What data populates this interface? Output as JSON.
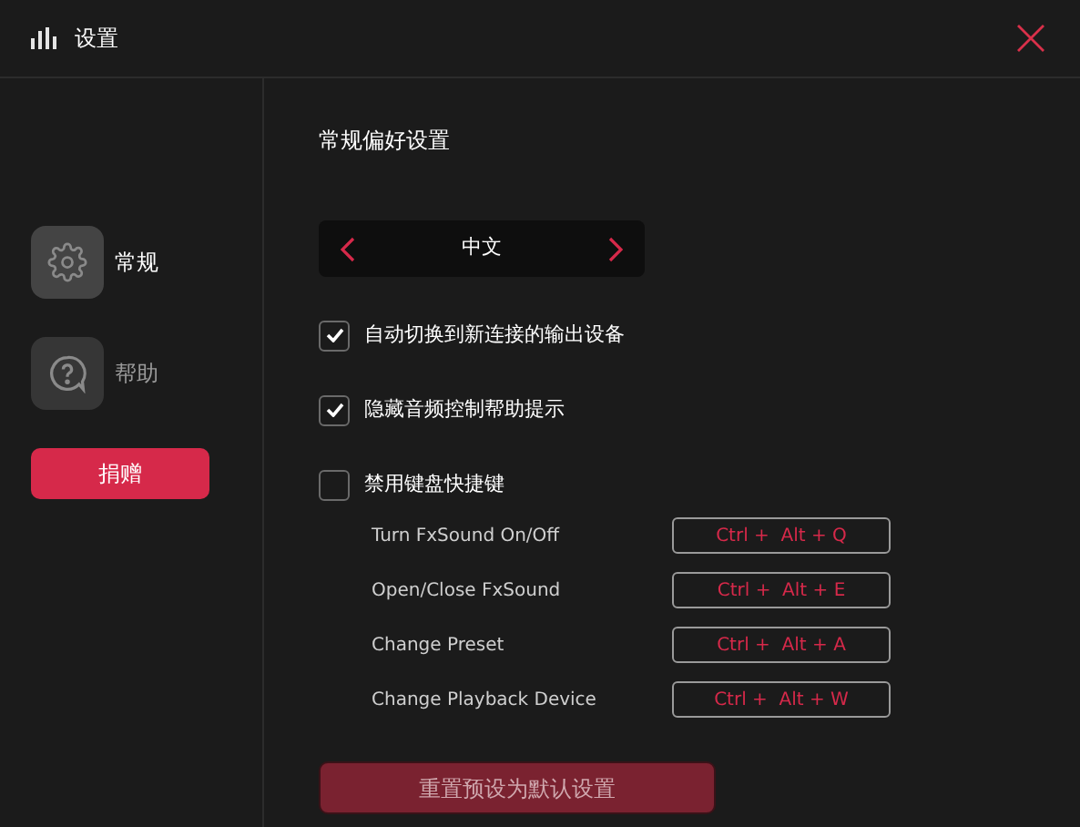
{
  "window": {
    "title": "设置"
  },
  "sidebar": {
    "items": [
      {
        "label": "常规",
        "kind": "settings",
        "selected": true
      },
      {
        "label": "帮助",
        "kind": "help",
        "selected": false
      }
    ],
    "donate_button": "捐赠"
  },
  "content": {
    "title": "常规偏好设置",
    "language": {
      "value": "中文"
    },
    "options": [
      {
        "label": "自动切换到新连接的输出设备",
        "checked": true
      },
      {
        "label": "隐藏音频控制帮助提示",
        "checked": true
      },
      {
        "label": "禁用键盘快捷键",
        "checked": false
      }
    ],
    "hotkeys": [
      {
        "label": "Turn FxSound On/Off",
        "keys": "Ctrl +  Alt + Q"
      },
      {
        "label": "Open/Close FxSound",
        "keys": "Ctrl +  Alt + E"
      },
      {
        "label": "Change Preset",
        "keys": "Ctrl +  Alt + A"
      },
      {
        "label": "Change Playback Device",
        "keys": "Ctrl +  Alt + W"
      }
    ],
    "reset_button": "重置预设为默认设置"
  }
}
